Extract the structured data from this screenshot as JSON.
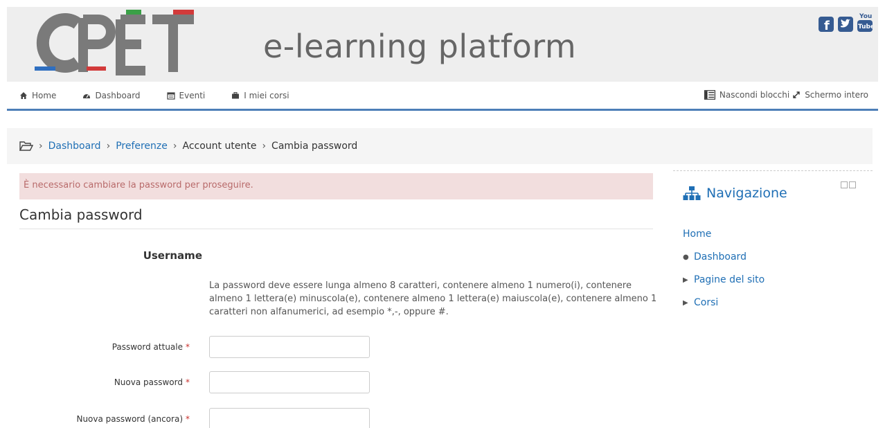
{
  "header": {
    "site_title": "e-learning platform",
    "logo_text": "CPET",
    "social": [
      "facebook-icon",
      "twitter-icon",
      "youtube-icon"
    ]
  },
  "nav": {
    "items": [
      {
        "label": "Home",
        "icon": "home-icon"
      },
      {
        "label": "Dashboard",
        "icon": "dashboard-icon"
      },
      {
        "label": "Eventi",
        "icon": "calendar-icon"
      },
      {
        "label": "I miei corsi",
        "icon": "briefcase-icon"
      }
    ],
    "right": [
      {
        "label": "Nascondi blocchi",
        "icon": "blocks-icon"
      },
      {
        "label": "Schermo intero",
        "icon": "expand-icon"
      }
    ]
  },
  "breadcrumb": {
    "items": [
      "Dashboard",
      "Preferenze",
      "Account utente",
      "Cambia password"
    ]
  },
  "main": {
    "alert": "È necessario cambiare la password per proseguire.",
    "heading": "Cambia password",
    "username_label": "Username",
    "rules_text": "La password deve essere lunga almeno 8 caratteri, contenere almeno 1 numero(i), contenere almeno 1 lettera(e) minuscola(e), contenere almeno 1 lettera(e) maiuscola(e), contenere almeno 1 caratteri non alfanumerici, ad esempio *,-, oppure #.",
    "fields": [
      {
        "label": "Password attuale",
        "value": ""
      },
      {
        "label": "Nuova password",
        "value": ""
      },
      {
        "label": "Nuova password (ancora)",
        "value": ""
      }
    ],
    "required_marker": "*"
  },
  "sidebar": {
    "title": "Navigazione",
    "home": "Home",
    "items": [
      "Dashboard",
      "Pagine del sito",
      "Corsi"
    ]
  },
  "colors": {
    "accent": "#1f6fb5",
    "nav_rule": "#4d7fb8",
    "alert_bg": "#f2dede",
    "alert_text": "#b86a6a",
    "header_bg": "#eeeeee"
  }
}
